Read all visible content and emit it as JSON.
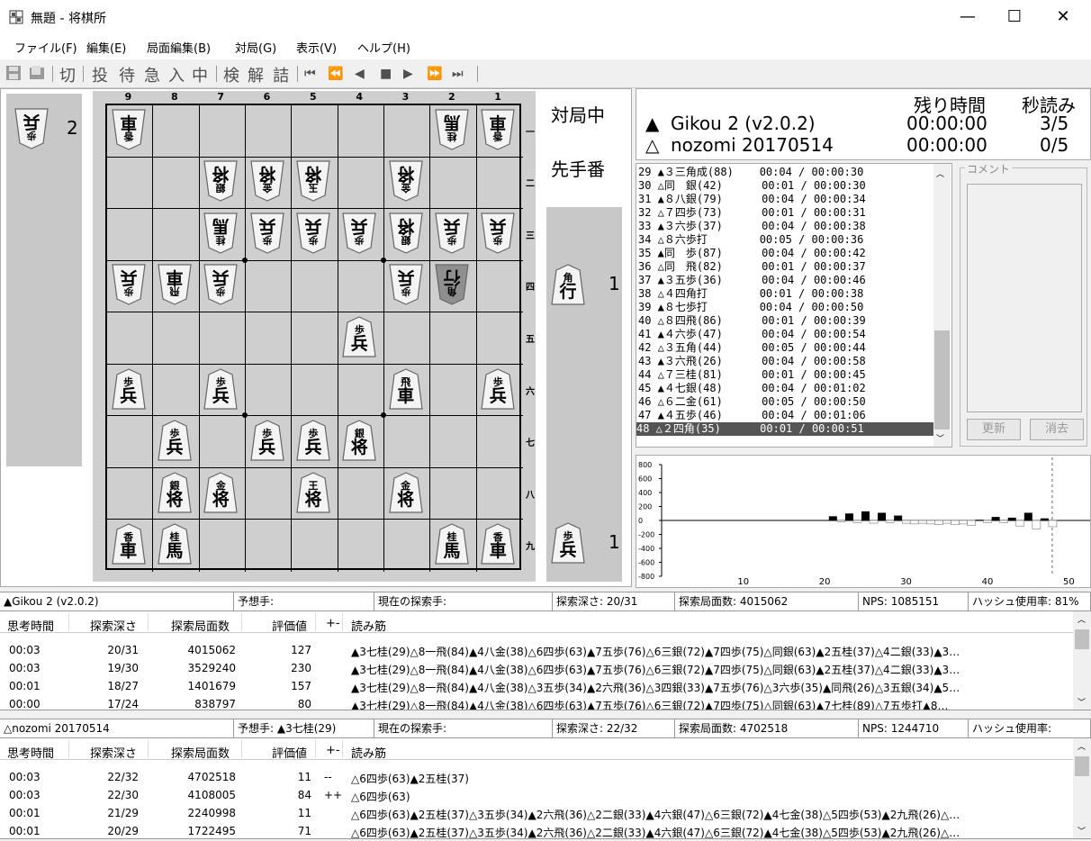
{
  "window": {
    "title": "無題 - 将棋所",
    "minimize": "—",
    "maximize": "☐",
    "close": "✕"
  },
  "menu": [
    "ファイル(F)",
    "編集(E)",
    "局面編集(B)",
    "対局(G)",
    "表示(V)",
    "ヘルプ(H)"
  ],
  "toolbar": {
    "labels": [
      "切",
      "投",
      "待",
      "急",
      "入",
      "中",
      "検",
      "解",
      "詰"
    ],
    "nav": [
      "⏮",
      "⏪",
      "◀",
      "■",
      "▶",
      "⏩",
      "⏭"
    ]
  },
  "board": {
    "files": [
      "9",
      "8",
      "7",
      "6",
      "5",
      "4",
      "3",
      "2",
      "1"
    ],
    "ranks": [
      "一",
      "二",
      "三",
      "四",
      "五",
      "六",
      "七",
      "八",
      "九"
    ],
    "pieces": [
      {
        "r": 0,
        "f": 0,
        "t": "香",
        "b": "車",
        "o": "g"
      },
      {
        "r": 0,
        "f": 7,
        "t": "桂",
        "b": "馬",
        "o": "g"
      },
      {
        "r": 0,
        "f": 8,
        "t": "香",
        "b": "車",
        "o": "g"
      },
      {
        "r": 1,
        "f": 2,
        "t": "銀",
        "b": "将",
        "o": "g"
      },
      {
        "r": 1,
        "f": 3,
        "t": "金",
        "b": "将",
        "o": "g"
      },
      {
        "r": 1,
        "f": 4,
        "t": "玉",
        "b": "将",
        "o": "g"
      },
      {
        "r": 1,
        "f": 6,
        "t": "金",
        "b": "将",
        "o": "g"
      },
      {
        "r": 2,
        "f": 2,
        "t": "桂",
        "b": "馬",
        "o": "g"
      },
      {
        "r": 2,
        "f": 3,
        "t": "歩",
        "b": "兵",
        "o": "g"
      },
      {
        "r": 2,
        "f": 4,
        "t": "歩",
        "b": "兵",
        "o": "g"
      },
      {
        "r": 2,
        "f": 5,
        "t": "歩",
        "b": "兵",
        "o": "g"
      },
      {
        "r": 2,
        "f": 6,
        "t": "銀",
        "b": "将",
        "o": "g"
      },
      {
        "r": 2,
        "f": 7,
        "t": "歩",
        "b": "兵",
        "o": "g"
      },
      {
        "r": 2,
        "f": 8,
        "t": "歩",
        "b": "兵",
        "o": "g"
      },
      {
        "r": 3,
        "f": 0,
        "t": "歩",
        "b": "兵",
        "o": "g"
      },
      {
        "r": 3,
        "f": 1,
        "t": "飛",
        "b": "車",
        "o": "g"
      },
      {
        "r": 3,
        "f": 2,
        "t": "歩",
        "b": "兵",
        "o": "g"
      },
      {
        "r": 3,
        "f": 6,
        "t": "歩",
        "b": "兵",
        "o": "g"
      },
      {
        "r": 3,
        "f": 7,
        "t": "角",
        "b": "行",
        "o": "g",
        "last": true
      },
      {
        "r": 4,
        "f": 5,
        "t": "歩",
        "b": "兵",
        "o": "s"
      },
      {
        "r": 5,
        "f": 0,
        "t": "歩",
        "b": "兵",
        "o": "s"
      },
      {
        "r": 5,
        "f": 2,
        "t": "歩",
        "b": "兵",
        "o": "s"
      },
      {
        "r": 5,
        "f": 6,
        "t": "飛",
        "b": "車",
        "o": "s"
      },
      {
        "r": 5,
        "f": 8,
        "t": "歩",
        "b": "兵",
        "o": "s"
      },
      {
        "r": 6,
        "f": 1,
        "t": "歩",
        "b": "兵",
        "o": "s"
      },
      {
        "r": 6,
        "f": 3,
        "t": "歩",
        "b": "兵",
        "o": "s"
      },
      {
        "r": 6,
        "f": 4,
        "t": "歩",
        "b": "兵",
        "o": "s"
      },
      {
        "r": 6,
        "f": 5,
        "t": "銀",
        "b": "将",
        "o": "s"
      },
      {
        "r": 7,
        "f": 1,
        "t": "銀",
        "b": "将",
        "o": "s"
      },
      {
        "r": 7,
        "f": 2,
        "t": "金",
        "b": "将",
        "o": "s"
      },
      {
        "r": 7,
        "f": 4,
        "t": "王",
        "b": "将",
        "o": "s"
      },
      {
        "r": 7,
        "f": 6,
        "t": "金",
        "b": "将",
        "o": "s"
      },
      {
        "r": 8,
        "f": 0,
        "t": "香",
        "b": "車",
        "o": "s"
      },
      {
        "r": 8,
        "f": 1,
        "t": "桂",
        "b": "馬",
        "o": "s"
      },
      {
        "r": 8,
        "f": 7,
        "t": "桂",
        "b": "馬",
        "o": "s"
      },
      {
        "r": 8,
        "f": 8,
        "t": "香",
        "b": "車",
        "o": "s"
      }
    ],
    "gote_hand": {
      "t": "歩",
      "b": "兵",
      "count": "2"
    },
    "sente_hand": [
      {
        "t": "角",
        "b": "行",
        "count": "1"
      },
      {
        "t": "歩",
        "b": "兵",
        "count": "1"
      }
    ],
    "status": "対局中",
    "turn": "先手番"
  },
  "players": {
    "remaining_header": "残り時間",
    "byoyomi_header": "秒読み",
    "sente": {
      "mark": "▲",
      "name": "Gikou 2 (v2.0.2)",
      "time": "00:00:00",
      "byoyomi": "3/5"
    },
    "gote": {
      "mark": "△",
      "name": "nozomi 20170514",
      "time": "00:00:00",
      "byoyomi": "0/5"
    }
  },
  "kifu": [
    "29 ▲３三角成(88)    00:04 / 00:00:30",
    "30 △同　銀(42)      00:01 / 00:00:30",
    "31 ▲８八銀(79)      00:04 / 00:00:34",
    "32 △７四歩(73)      00:01 / 00:00:31",
    "33 ▲３六歩(37)      00:04 / 00:00:38",
    "34 △８六歩打        00:05 / 00:00:36",
    "35 ▲同　歩(87)      00:04 / 00:00:42",
    "36 △同　飛(82)      00:01 / 00:00:37",
    "37 ▲３五歩(36)      00:04 / 00:00:46",
    "38 △４四角打        00:01 / 00:00:38",
    "39 ▲８七歩打        00:04 / 00:00:50",
    "40 △８四飛(86)      00:01 / 00:00:39",
    "41 ▲４六歩(47)      00:04 / 00:00:54",
    "42 △３五角(44)      00:05 / 00:00:44",
    "43 ▲３六飛(26)      00:04 / 00:00:58",
    "44 △７三桂(81)      00:01 / 00:00:45",
    "45 ▲４七銀(48)      00:04 / 00:01:02",
    "46 △６二金(61)      00:05 / 00:00:50",
    "47 ▲４五歩(46)      00:04 / 00:01:06",
    "48 △２四角(35)      00:01 / 00:00:51"
  ],
  "comment": {
    "label": "コメント",
    "update": "更新",
    "clear": "消去"
  },
  "graph": {
    "y_ticks": [
      "800",
      "600",
      "400",
      "200",
      "0",
      "-200",
      "-400",
      "-600",
      "-800"
    ],
    "x_ticks": [
      "10",
      "20",
      "30",
      "40",
      "50"
    ],
    "values": [
      [
        21,
        60
      ],
      [
        22,
        -20
      ],
      [
        23,
        100
      ],
      [
        24,
        -30
      ],
      [
        25,
        130
      ],
      [
        26,
        -40
      ],
      [
        27,
        110
      ],
      [
        28,
        -30
      ],
      [
        29,
        70
      ],
      [
        30,
        -40
      ],
      [
        31,
        -50
      ],
      [
        32,
        -40
      ],
      [
        33,
        -50
      ],
      [
        34,
        -60
      ],
      [
        35,
        -40
      ],
      [
        36,
        -60
      ],
      [
        37,
        -50
      ],
      [
        38,
        -70
      ],
      [
        39,
        10
      ],
      [
        40,
        -30
      ],
      [
        41,
        50
      ],
      [
        42,
        -30
      ],
      [
        43,
        40
      ],
      [
        44,
        -80
      ],
      [
        45,
        110
      ],
      [
        46,
        -120
      ],
      [
        47,
        30
      ],
      [
        48,
        -90
      ]
    ]
  },
  "engine1": {
    "info": [
      "▲Gikou 2 (v2.0.2)",
      "予想手:",
      "現在の探索手:",
      "探索深さ: 20/31",
      "探索局面数: 4015062",
      "NPS: 1085151",
      "ハッシュ使用率: 81%"
    ],
    "headers": [
      "思考時間",
      "探索深さ",
      "探索局面数",
      "評価値",
      "+-",
      "読み筋"
    ],
    "rows": [
      [
        "00:03",
        "20/31",
        "4015062",
        "127",
        "",
        "▲3七桂(29)△8一飛(84)▲4八金(38)△6四歩(63)▲7五歩(76)△6三銀(72)▲7四歩(75)△同銀(63)▲2五桂(37)△4二銀(33)▲3…"
      ],
      [
        "00:03",
        "19/30",
        "3529240",
        "230",
        "",
        "▲3七桂(29)△8一飛(84)▲4八金(38)△6四歩(63)▲7五歩(76)△6三銀(72)▲7四歩(75)△同銀(63)▲2五桂(37)△4二銀(33)▲3…"
      ],
      [
        "00:01",
        "18/27",
        "1401679",
        "157",
        "",
        "▲3七桂(29)△8一飛(84)▲4八金(38)△3五歩(34)▲2六飛(36)△3四銀(33)▲7五歩(76)△3六歩(35)▲同飛(26)△3五銀(34)▲5…"
      ],
      [
        "00:00",
        "17/24",
        "838797",
        "80",
        "",
        "▲3七桂(29)△8一飛(84)▲4八金(38)△6四歩(63)▲7五歩(76)△6三銀(72)▲7四歩(75)△同銀(63)▲7七桂(89)△7五歩打▲8…"
      ]
    ]
  },
  "engine2": {
    "info": [
      "△nozomi 20170514",
      "予想手: ▲3七桂(29)",
      "現在の探索手:",
      "探索深さ: 22/32",
      "探索局面数: 4702518",
      "NPS: 1244710",
      "ハッシュ使用率:"
    ],
    "headers": [
      "思考時間",
      "探索深さ",
      "探索局面数",
      "評価値",
      "+-",
      "読み筋"
    ],
    "rows": [
      [
        "00:03",
        "22/32",
        "4702518",
        "11",
        "--",
        "△6四歩(63)▲2五桂(37)"
      ],
      [
        "00:03",
        "22/30",
        "4108005",
        "84",
        "++",
        "△6四歩(63)"
      ],
      [
        "00:01",
        "21/29",
        "2240998",
        "11",
        "",
        "△6四歩(63)▲2五桂(37)△3五歩(34)▲2六飛(36)△2二銀(33)▲4六銀(47)△6三銀(72)▲4七金(38)△5四歩(53)▲2九飛(26)△…"
      ],
      [
        "00:01",
        "20/29",
        "1722495",
        "71",
        "",
        "△6四歩(63)▲2五桂(37)△3五歩(34)▲2六飛(36)△2二銀(33)▲4六銀(47)△6三銀(72)▲4七金(38)△5四歩(53)▲2九飛(26)△…"
      ]
    ]
  }
}
